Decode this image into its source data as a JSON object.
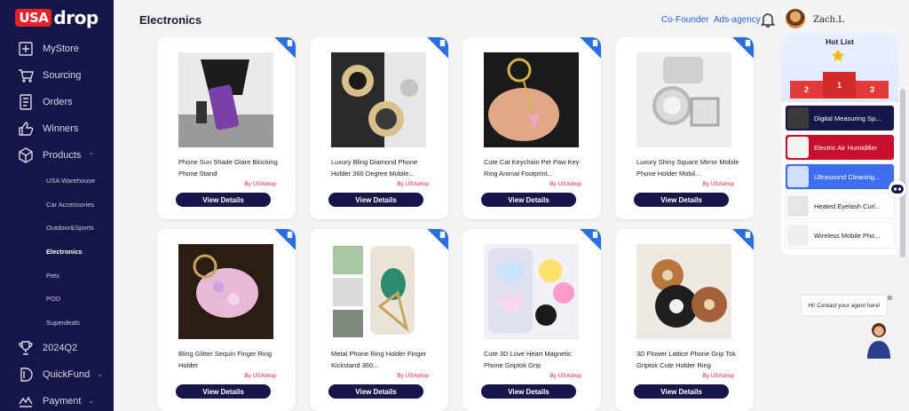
{
  "brand": {
    "usa": "USA",
    "drop": "drop"
  },
  "sidebar": {
    "items": [
      {
        "label": "MyStore",
        "icon": "store-icon"
      },
      {
        "label": "Sourcing",
        "icon": "cart-icon"
      },
      {
        "label": "Orders",
        "icon": "orders-icon"
      },
      {
        "label": "Winners",
        "icon": "thumbs-up-icon"
      },
      {
        "label": "Products",
        "icon": "box-icon"
      }
    ],
    "sub_items": [
      "USA Warehouse",
      "Car Accessories",
      "Outdoor&Sports",
      "Electronics",
      "Pets",
      "POD",
      "Superdeals"
    ],
    "active_sub": "Electronics",
    "bottom_items": [
      {
        "label": "2024Q2",
        "icon": "trophy-icon"
      },
      {
        "label": "QuickFund",
        "icon": "fund-icon"
      },
      {
        "label": "Payment",
        "icon": "payment-icon"
      }
    ]
  },
  "header": {
    "title": "Electronics",
    "link1": "Co-Founder",
    "link2": "Ads-agency",
    "user": "Zach.L"
  },
  "products": [
    {
      "title": "Phone Sun Shade Glare Blocking Phone Stand",
      "by": "By USAdrop",
      "button": "View Details"
    },
    {
      "title": "Luxury Bling Diamond Phone Holder 360 Degree Mobile...",
      "by": "By USAdrop",
      "button": "View Details"
    },
    {
      "title": "Cute Cat Keychain Pet Paw Key Ring Animal Footprint...",
      "by": "By USAdrop",
      "button": "View Details"
    },
    {
      "title": "Luxury Shiny Square Mirror Mobile Phone Holder Mobil...",
      "by": "By USAdrop",
      "button": "View Details"
    },
    {
      "title": "Bling Glitter Sequin Finger Ring Holder",
      "by": "By USAdrop",
      "button": "View Details"
    },
    {
      "title": "Metal Phone Ring Holder Finger Kickstand 360...",
      "by": "By USAdrop",
      "button": "View Details"
    },
    {
      "title": "Cute 3D Love Heart Magnetic Phone Griptok Grip",
      "by": "By USAdrop",
      "button": "View Details"
    },
    {
      "title": "3D Flower Lattice Phone Grip Tok Griptok Cute Holder Ring",
      "by": "By USAdrop",
      "button": "View Details"
    }
  ],
  "hot_list": {
    "title": "Hot List",
    "ranks": [
      "2",
      "1",
      "3"
    ],
    "items": [
      {
        "label": "Digital Measuring Sp...",
        "bg": "#17164a",
        "fg": "#ffffff"
      },
      {
        "label": "Electric Air Humidifier",
        "bg": "#c8102e",
        "fg": "#ffffff"
      },
      {
        "label": "Ultrasound Cleaning...",
        "bg": "#3d6ff0",
        "fg": "#ffffff"
      },
      {
        "label": "Heated Eyelash Curl...",
        "bg": "#ffffff",
        "fg": "#222222"
      },
      {
        "label": "Wireless Mobile Pho...",
        "bg": "#ffffff",
        "fg": "#222222"
      }
    ]
  },
  "contact_text": "Hi! Contact your agent here!",
  "colors": {
    "sidebar": "#17164a",
    "accent": "#e8202a",
    "link": "#2b5fd9",
    "corner": "#2a6fe0"
  }
}
